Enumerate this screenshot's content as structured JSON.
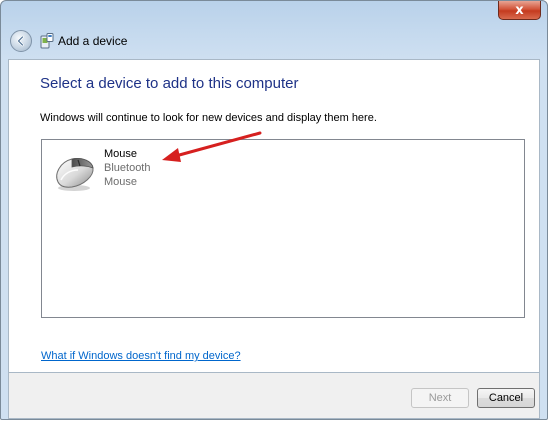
{
  "window": {
    "title": "Add a device",
    "close_glyph": "x"
  },
  "page": {
    "heading": "Select a device to add to this computer",
    "info": "Windows will continue to look for new devices and display them here."
  },
  "devices": [
    {
      "name": "Mouse",
      "connection": "Bluetooth",
      "kind": "Mouse",
      "icon": "mouse-icon"
    }
  ],
  "help_link": "What if Windows doesn't find my device?",
  "buttons": {
    "next": "Next",
    "cancel": "Cancel"
  },
  "colors": {
    "heading": "#1e3287",
    "link": "#0066cc",
    "annotation_arrow": "#d6201f"
  }
}
